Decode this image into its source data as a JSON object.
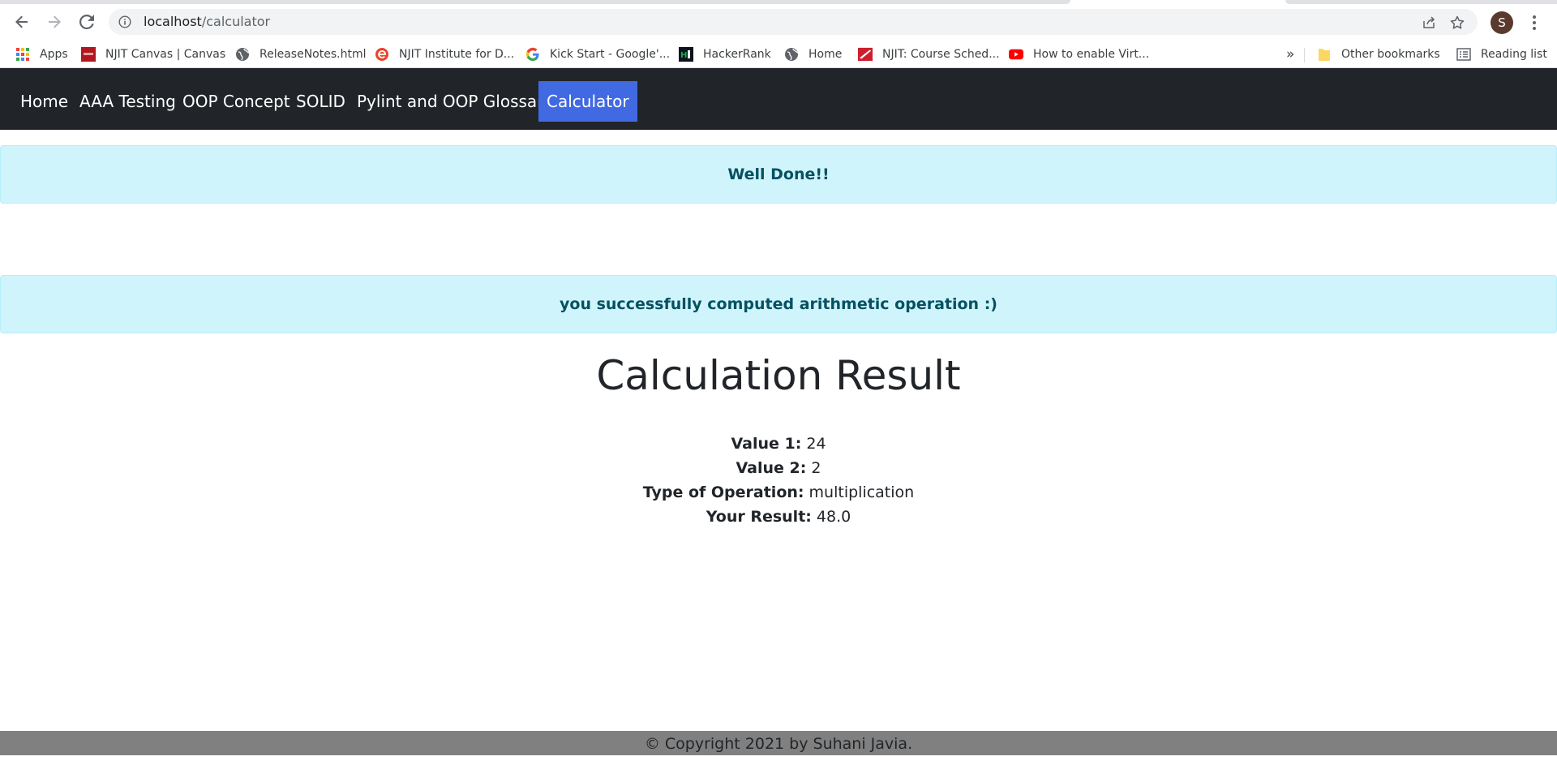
{
  "browser": {
    "url_host": "localhost",
    "url_path": "/calculator",
    "profile_initial": "S",
    "bookmarks": [
      {
        "label": "Apps",
        "icon": "apps-grid-icon"
      },
      {
        "label": "NJIT Canvas | Canvas",
        "icon": "canvas-icon"
      },
      {
        "label": "ReleaseNotes.html",
        "icon": "globe-icon"
      },
      {
        "label": "NJIT Institute for D...",
        "icon": "njit-e-icon"
      },
      {
        "label": "Kick Start - Google'...",
        "icon": "google-icon"
      },
      {
        "label": "HackerRank",
        "icon": "hackerrank-icon"
      },
      {
        "label": "Home",
        "icon": "globe-icon"
      },
      {
        "label": "NJIT: Course Sched...",
        "icon": "njit-icon"
      },
      {
        "label": "How to enable Virt...",
        "icon": "youtube-icon"
      }
    ],
    "overflow_label": "»",
    "other_bookmarks": "Other bookmarks",
    "reading_list": "Reading list"
  },
  "nav": {
    "items": [
      "Home",
      "AAA Testing",
      "OOP Concept",
      "SOLID",
      "Pylint and OOP Glossary",
      "Calculator"
    ],
    "active": "Calculator"
  },
  "alerts": {
    "first": "Well Done!!",
    "second": "you successfully computed arithmetic operation :)"
  },
  "result": {
    "title": "Calculation Result",
    "value1_label": "Value 1:",
    "value1": "24",
    "value2_label": "Value 2:",
    "value2": "2",
    "operation_label": "Type of Operation:",
    "operation": "multiplication",
    "result_label": "Your Result:",
    "result": "48.0"
  },
  "footer": {
    "text": "© Copyright 2021 by Suhani Javia."
  },
  "colors": {
    "navbar_bg": "#212529",
    "active_nav": "#4169e1",
    "alert_bg": "#cff4fc",
    "alert_text": "#055160",
    "footer_bg": "#808080"
  }
}
